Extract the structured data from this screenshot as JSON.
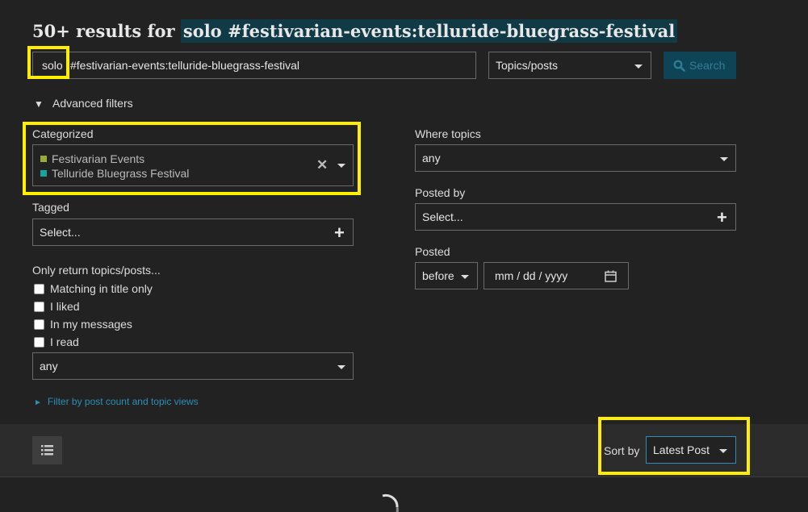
{
  "heading": {
    "prefix": "50+ results for",
    "query": "solo #festivarian-events:telluride-bluegrass-festival"
  },
  "search": {
    "term": "solo",
    "rest": "#festivarian-events:telluride-bluegrass-festival",
    "type_value": "Topics/posts",
    "button_label": "Search",
    "button_icon": "search-icon"
  },
  "advanced": {
    "toggle_label": "Advanced filters",
    "toggle_icon": "triangle-down-icon",
    "categorized": {
      "label": "Categorized",
      "items": [
        {
          "name": "Festivarian Events",
          "color": "#9aab35"
        },
        {
          "name": "Telluride Bluegrass Festival",
          "color": "#1aa39a"
        }
      ],
      "clear_icon": "close-icon"
    },
    "tagged": {
      "label": "Tagged",
      "value": "Select..."
    },
    "only_return": {
      "label": "Only return topics/posts...",
      "options": [
        "Matching in title only",
        "I liked",
        "In my messages",
        "I read"
      ],
      "select_value": "any"
    },
    "where_topics": {
      "label": "Where topics",
      "value": "any"
    },
    "posted_by": {
      "label": "Posted by",
      "value": "Select..."
    },
    "posted": {
      "label": "Posted",
      "when": "before",
      "date_placeholder": "mm / dd / yyyy"
    },
    "filter_link": "Filter by post count and topic views"
  },
  "footer": {
    "sort_label": "Sort by",
    "sort_value": "Latest Post",
    "list_icon": "list-icon"
  },
  "colors": {
    "highlight": "#ffee00",
    "accent": "#2c8fb8",
    "background": "#222222"
  }
}
